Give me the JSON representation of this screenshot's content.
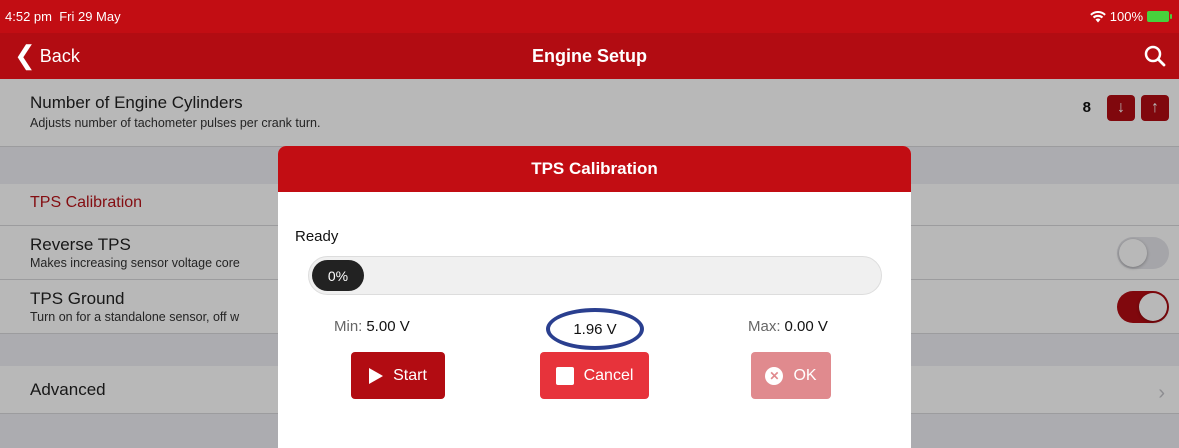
{
  "status_bar": {
    "time": "4:52 pm",
    "date": "Fri 29 May",
    "battery": "100%"
  },
  "nav": {
    "back_label": "Back",
    "title": "Engine Setup"
  },
  "settings": {
    "cylinders": {
      "title": "Number of Engine Cylinders",
      "subtitle": "Adjusts number of tachometer pulses per crank turn.",
      "value": "8"
    },
    "tps_section_label": "TPS Calibration",
    "reverse_tps": {
      "title": "Reverse TPS",
      "subtitle": "Makes increasing sensor voltage core",
      "enabled": false
    },
    "tps_ground": {
      "title": "TPS Ground",
      "subtitle": "Turn on for a standalone sensor, off w",
      "enabled": true
    },
    "advanced_label": "Advanced"
  },
  "dialog": {
    "title": "TPS Calibration",
    "status": "Ready",
    "progress_label": "0%",
    "progress": 0,
    "min_label": "Min:",
    "min_value": "5.00 V",
    "current_value": "1.96 V",
    "max_label": "Max:",
    "max_value": "0.00 V",
    "start_label": "Start",
    "cancel_label": "Cancel",
    "ok_label": "OK"
  },
  "colors": {
    "brand_red": "#b20c12",
    "status_red": "#c20d13",
    "cancel_red": "#e7333b",
    "ok_disabled": "#e08a8e",
    "annotation_blue": "#2a3f8f"
  }
}
